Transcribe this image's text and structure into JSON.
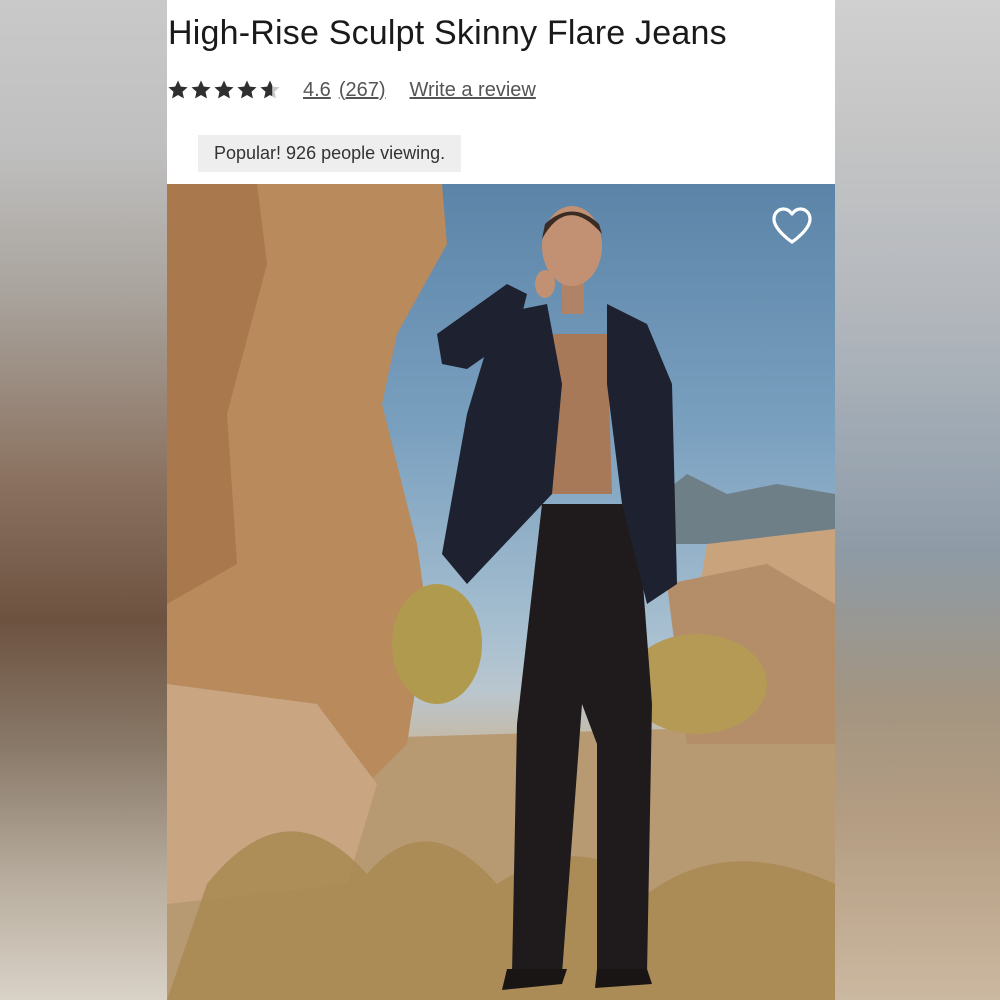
{
  "product": {
    "title": "High-Rise Sculpt Skinny Flare Jeans",
    "rating": {
      "value": "4.6",
      "count": "(267)",
      "stars": 4.6,
      "max_stars": 5
    },
    "write_review": "Write a review",
    "popular_badge": "Popular! 926 people viewing."
  },
  "hero": {
    "favorite_icon": "heart-outline-icon"
  },
  "colors": {
    "star": "#2f2f2f",
    "link": "#555555",
    "badge_bg": "#eeeeee"
  }
}
